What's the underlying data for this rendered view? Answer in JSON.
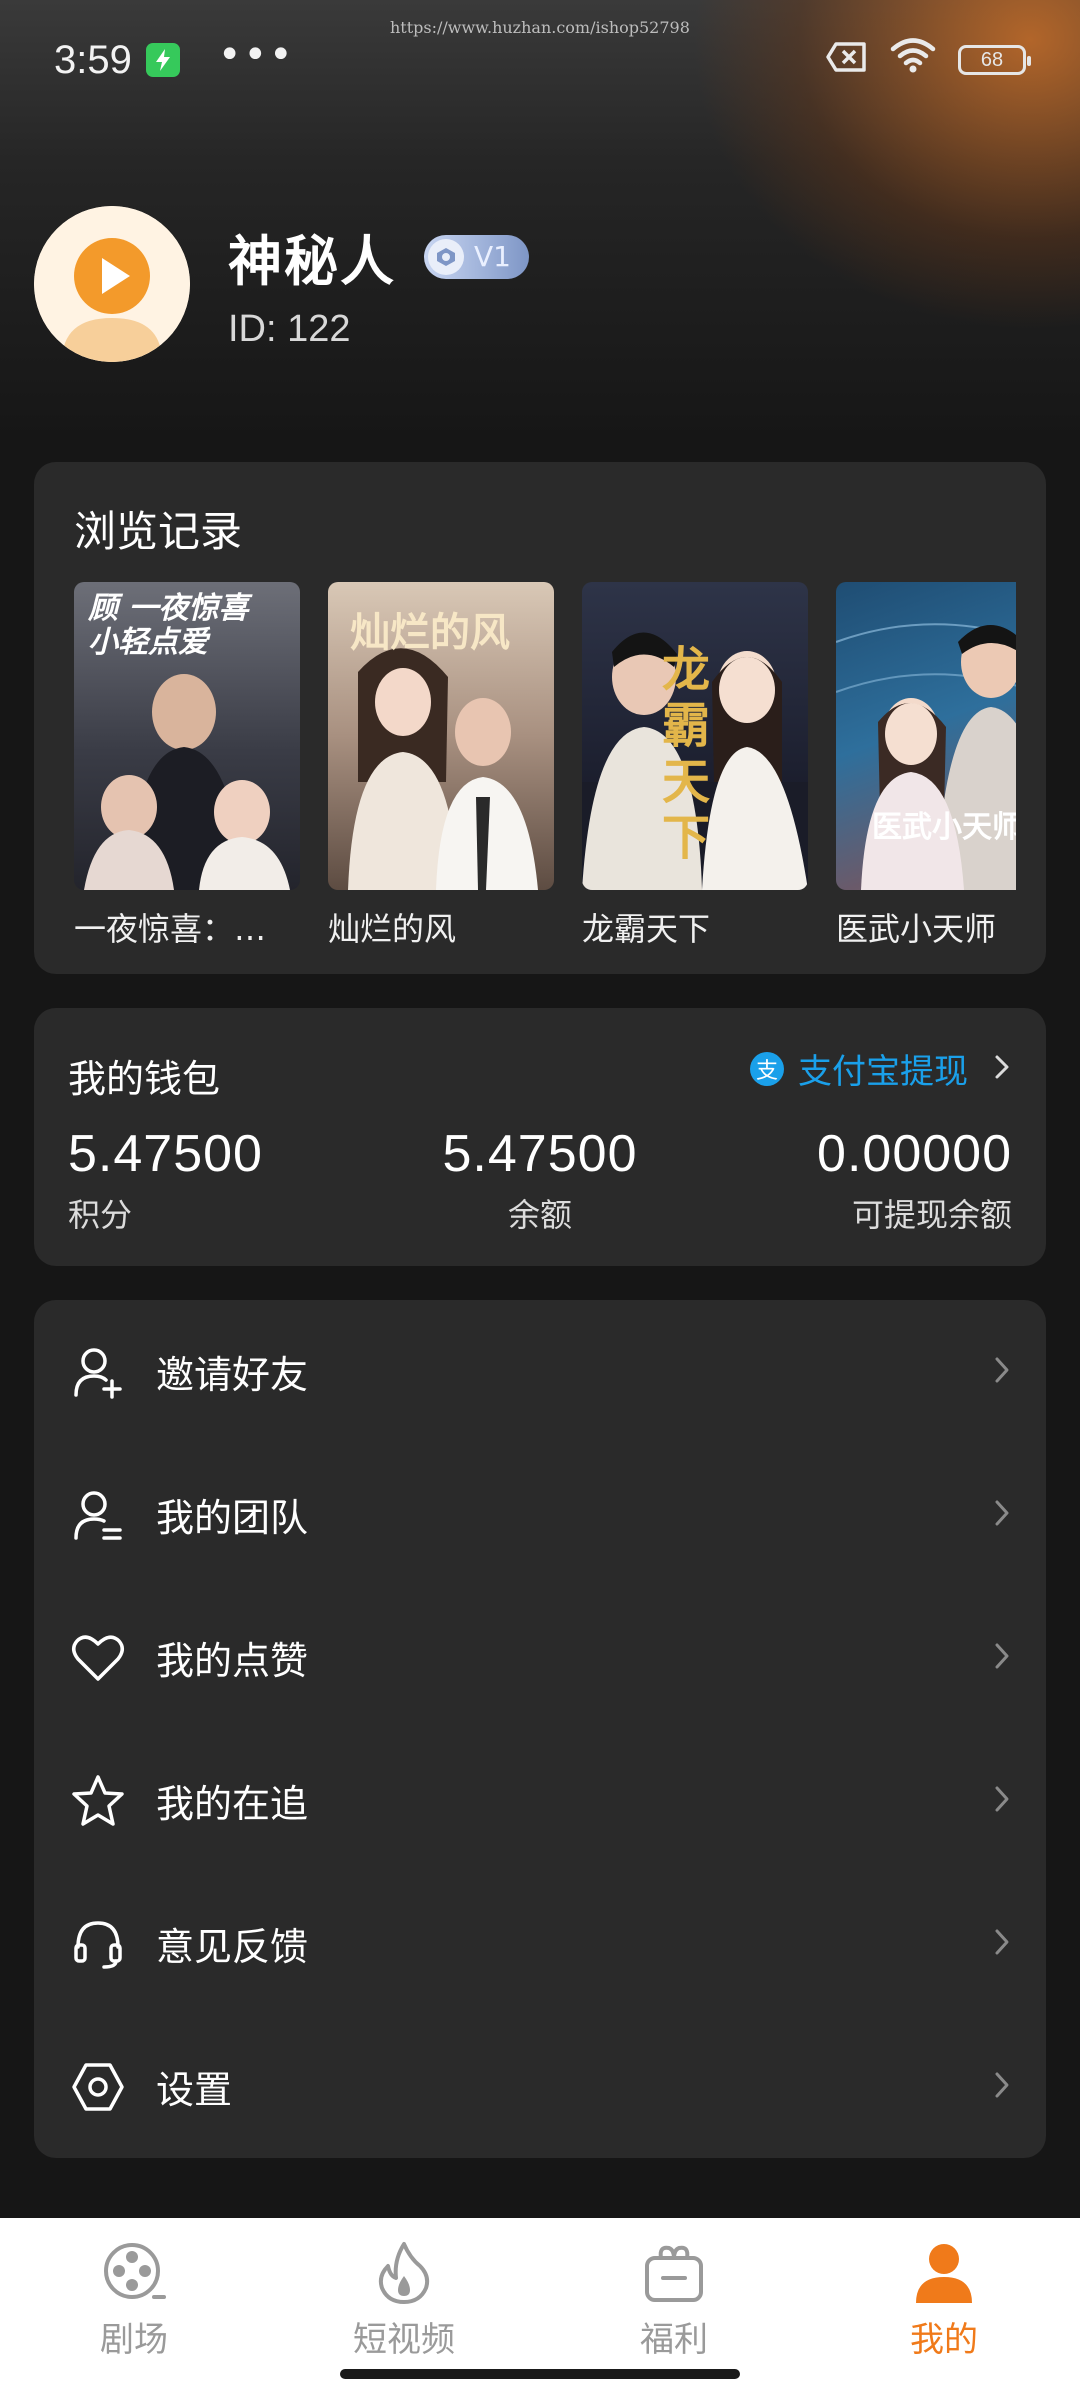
{
  "status_bar": {
    "time": "3:59",
    "dots": "•••",
    "battery": "68",
    "watermark": "https://www.huzhan.com/ishop52798"
  },
  "profile": {
    "name": "神秘人",
    "vip_level": "V1",
    "id_text": "ID: 122"
  },
  "history": {
    "title": "浏览记录",
    "items": [
      {
        "title": "一夜惊喜：…",
        "poster_text": "顾 一夜惊喜 小轻点爱",
        "colors": [
          "#6d6f78",
          "#2b2d38"
        ]
      },
      {
        "title": "灿烂的风",
        "poster_text": "灿烂的风",
        "colors": [
          "#c9b7a6",
          "#6e5a4d"
        ]
      },
      {
        "title": "龙霸天下",
        "poster_text": "龙霸天下",
        "colors": [
          "#3a3f55",
          "#141622"
        ]
      },
      {
        "title": "医武小天师",
        "poster_text": "医武小天师",
        "colors": [
          "#2e5f86",
          "#8a6a5e"
        ]
      }
    ]
  },
  "wallet": {
    "title": "我的钱包",
    "withdraw_label": "支付宝提现",
    "alipay_glyph": "支",
    "stats": [
      {
        "value": "5.47500",
        "label": "积分"
      },
      {
        "value": "5.47500",
        "label": "余额"
      },
      {
        "value": "0.00000",
        "label": "可提现余额"
      }
    ]
  },
  "menu": {
    "items": [
      {
        "label": "邀请好友",
        "icon": "invite-friend-icon"
      },
      {
        "label": "我的团队",
        "icon": "team-icon"
      },
      {
        "label": "我的点赞",
        "icon": "heart-icon"
      },
      {
        "label": "我的在追",
        "icon": "star-icon"
      },
      {
        "label": "意见反馈",
        "icon": "headset-icon"
      },
      {
        "label": "设置",
        "icon": "settings-icon"
      }
    ]
  },
  "tabs": {
    "items": [
      {
        "label": "剧场",
        "icon": "film-reel-icon",
        "active": false
      },
      {
        "label": "短视频",
        "icon": "flame-icon",
        "active": false
      },
      {
        "label": "福利",
        "icon": "gift-box-icon",
        "active": false
      },
      {
        "label": "我的",
        "icon": "person-icon",
        "active": true
      }
    ],
    "active_color": "#f07a1a",
    "inactive_color": "#9a9a9a"
  },
  "colors": {
    "accent": "#f07a1a",
    "alipay_blue": "#1aa0ea",
    "card_bg": "#2a2a2a"
  }
}
